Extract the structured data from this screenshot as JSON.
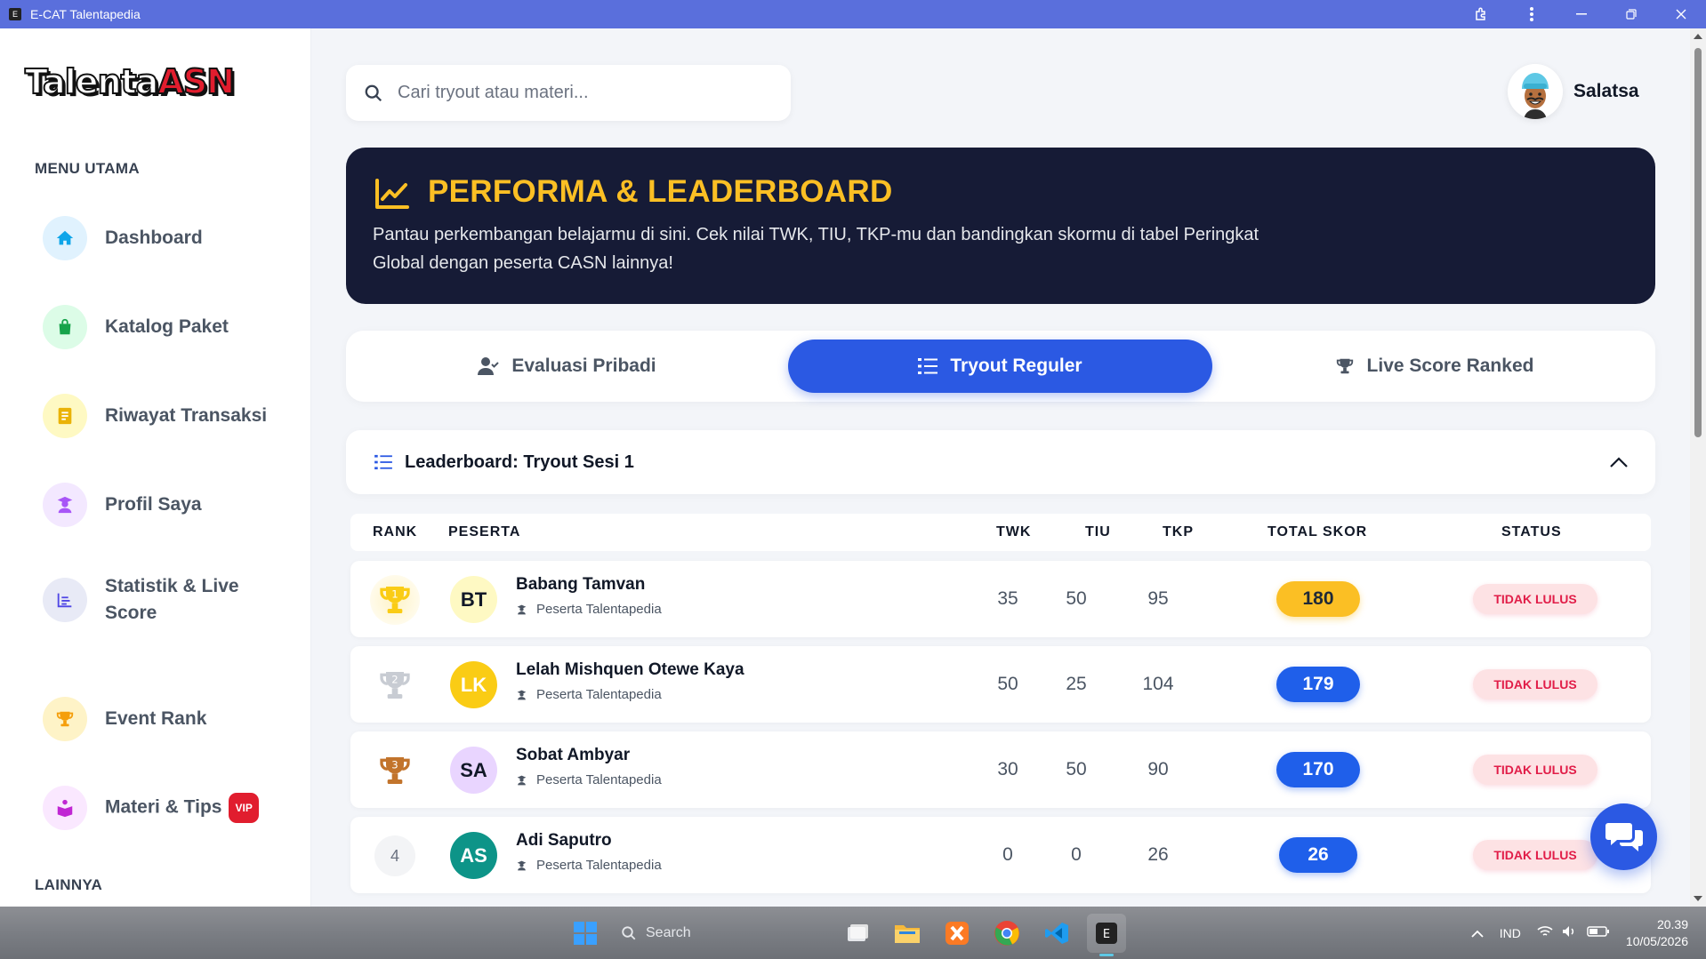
{
  "window": {
    "title": "E-CAT Talentapedia",
    "app_icon_letter": "E"
  },
  "logo": {
    "part1": "Talenta",
    "part2": "ASN"
  },
  "sidebar": {
    "section_main": "MENU UTAMA",
    "section_other": "LAINNYA",
    "items": [
      {
        "label": "Dashboard",
        "icon": "home-icon",
        "color": "#0ea5e9",
        "bg": "#e0f2fe"
      },
      {
        "label": "Katalog Paket",
        "icon": "shopping-bag-icon",
        "color": "#16a34a",
        "bg": "#dcfce7"
      },
      {
        "label": "Riwayat Transaksi",
        "icon": "receipt-icon",
        "color": "#eab308",
        "bg": "#fef9c3"
      },
      {
        "label": "Profil Saya",
        "icon": "user-graduate-icon",
        "color": "#a855f7",
        "bg": "#f3e8ff"
      },
      {
        "label": "Statistik & Live Score",
        "icon": "chart-icon",
        "color": "#4f46e5",
        "bg": "#e8eaf6"
      },
      {
        "label": "Event Rank",
        "icon": "trophy-icon",
        "color": "#f59e0b",
        "bg": "#fef3c7"
      },
      {
        "label": "Materi & Tips",
        "icon": "book-reader-icon",
        "color": "#c026d3",
        "bg": "#fae8ff",
        "badge": "VIP"
      }
    ]
  },
  "search": {
    "placeholder": "Cari tryout atau materi..."
  },
  "user": {
    "name": "Salatsa"
  },
  "hero": {
    "title": "PERFORMA & LEADERBOARD",
    "description": "Pantau perkembangan belajarmu di sini. Cek nilai TWK, TIU, TKP-mu dan bandingkan skormu di tabel Peringkat Global dengan peserta CASN lainnya!"
  },
  "tabs": [
    {
      "label": "Evaluasi Pribadi",
      "icon": "user-check-icon",
      "active": false
    },
    {
      "label": "Tryout Reguler",
      "icon": "list-icon",
      "active": true
    },
    {
      "label": "Live Score Ranked",
      "icon": "trophy-icon",
      "active": false
    }
  ],
  "leaderboard": {
    "title": "Leaderboard: Tryout Sesi 1",
    "columns": {
      "rank": "RANK",
      "peserta": "PESERTA",
      "twk": "TWK",
      "tiu": "TIU",
      "tkp": "TKP",
      "total": "TOTAL SKOR",
      "status": "STATUS"
    },
    "rows": [
      {
        "rank": "1",
        "initials": "BT",
        "name": "Babang Tamvan",
        "sub": "Peserta Talentapedia",
        "twk": "35",
        "tiu": "50",
        "tkp": "95",
        "total": "180",
        "status": "TIDAK LULUS"
      },
      {
        "rank": "2",
        "initials": "LK",
        "name": "Lelah Mishquen Otewe Kaya",
        "sub": "Peserta Talentapedia",
        "twk": "50",
        "tiu": "25",
        "tkp": "104",
        "total": "179",
        "status": "TIDAK LULUS"
      },
      {
        "rank": "3",
        "initials": "SA",
        "name": "Sobat Ambyar",
        "sub": "Peserta Talentapedia",
        "twk": "30",
        "tiu": "50",
        "tkp": "90",
        "total": "170",
        "status": "TIDAK LULUS"
      },
      {
        "rank": "4",
        "initials": "AS",
        "name": "Adi Saputro",
        "sub": "Peserta Talentapedia",
        "twk": "0",
        "tiu": "0",
        "tkp": "26",
        "total": "26",
        "status": "TIDAK LULUS"
      }
    ]
  },
  "taskbar": {
    "search_label": "Search",
    "language": "IND",
    "time": "20.39",
    "date": "10/05/2026",
    "tray_letter": "E"
  }
}
